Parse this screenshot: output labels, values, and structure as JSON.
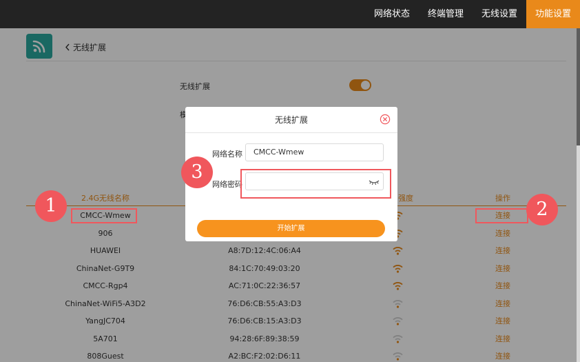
{
  "nav": {
    "items": [
      {
        "label": "网络状态"
      },
      {
        "label": "终端管理"
      },
      {
        "label": "无线设置"
      },
      {
        "label": "功能设置",
        "active": true
      }
    ]
  },
  "header": {
    "back_label": "无线扩展",
    "icon": "wifi-signal-icon"
  },
  "settings": {
    "extend_label": "无线扩展",
    "extend_on": true,
    "mode_label": "模"
  },
  "table": {
    "headers": {
      "ssid": "2.4G无线名称",
      "signal": "强度",
      "action": "操作"
    },
    "rows": [
      {
        "ssid": "CMCC-Wmew",
        "mac": "",
        "signal": 3,
        "action": "连接"
      },
      {
        "ssid": "906",
        "mac": "",
        "signal": 3,
        "action": "连接"
      },
      {
        "ssid": "HUAWEI",
        "mac": "A8:7D:12:4C:06:A4",
        "signal": 3,
        "action": "连接"
      },
      {
        "ssid": "ChinaNet-G9T9",
        "mac": "84:1C:70:49:03:20",
        "signal": 3,
        "action": "连接"
      },
      {
        "ssid": "CMCC-Rgp4",
        "mac": "AC:71:0C:22:36:57",
        "signal": 3,
        "action": "连接"
      },
      {
        "ssid": "ChinaNet-WiFi5-A3D2",
        "mac": "76:D6:CB:55:A3:D3",
        "signal": 1,
        "action": "连接"
      },
      {
        "ssid": "YangJC704",
        "mac": "76:D6:CB:15:A3:D3",
        "signal": 1,
        "action": "连接"
      },
      {
        "ssid": "5A701",
        "mac": "94:28:6F:89:38:59",
        "signal": 1,
        "action": "连接"
      },
      {
        "ssid": "808Guest",
        "mac": "A2:BC:F2:02:D6:11",
        "signal": 1,
        "action": "连接"
      }
    ]
  },
  "modal": {
    "title": "无线扩展",
    "ssid_label": "网络名称",
    "ssid_value": "CMCC-Wmew",
    "password_label": "网络密码",
    "password_value": "",
    "submit_label": "开始扩展"
  },
  "annotations": {
    "badge_1": "1",
    "badge_2": "2",
    "badge_3": "3"
  },
  "colors": {
    "accent": "#e9891a",
    "button": "#f7931e",
    "annotation": "#f0575c",
    "app_icon": "#2aa89e",
    "topbar": "#232323"
  }
}
